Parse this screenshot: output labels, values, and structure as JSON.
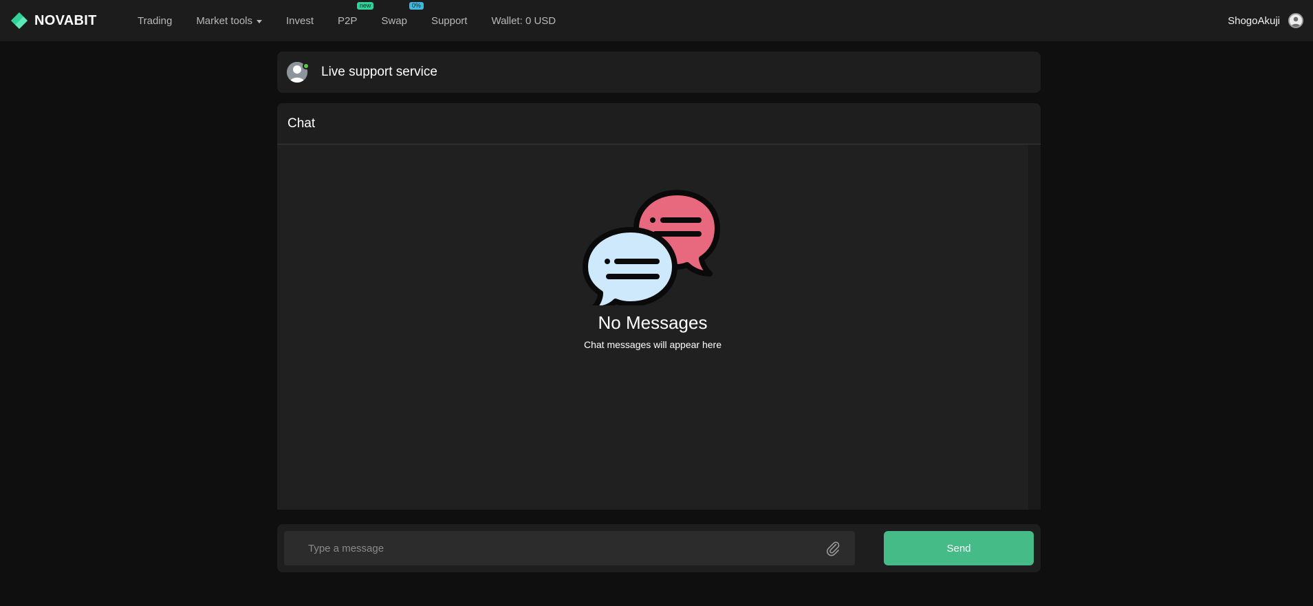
{
  "brand": {
    "name": "NOVABIT",
    "color": "#2fd39a"
  },
  "nav": {
    "items": [
      {
        "label": "Trading",
        "badge": null
      },
      {
        "label": "Market tools",
        "badge": null,
        "dropdown": true
      },
      {
        "label": "Invest",
        "badge": null
      },
      {
        "label": "P2P",
        "badge": "new"
      },
      {
        "label": "Swap",
        "badge": "0%"
      },
      {
        "label": "Support",
        "badge": null
      },
      {
        "label": "Wallet: 0 USD",
        "badge": null
      }
    ]
  },
  "user": {
    "name": "ShogoAkuji",
    "icon": "user-avatar-icon"
  },
  "support": {
    "title": "Live support service",
    "status": "online",
    "status_color": "#5cc84a"
  },
  "chat": {
    "heading": "Chat",
    "empty_title": "No Messages",
    "empty_subtitle": "Chat messages will appear here",
    "illustration": "chat-bubbles-icon"
  },
  "composer": {
    "placeholder": "Type a message",
    "value": "",
    "attach_icon": "paperclip-icon",
    "send_label": "Send",
    "send_color": "#45bb88"
  }
}
